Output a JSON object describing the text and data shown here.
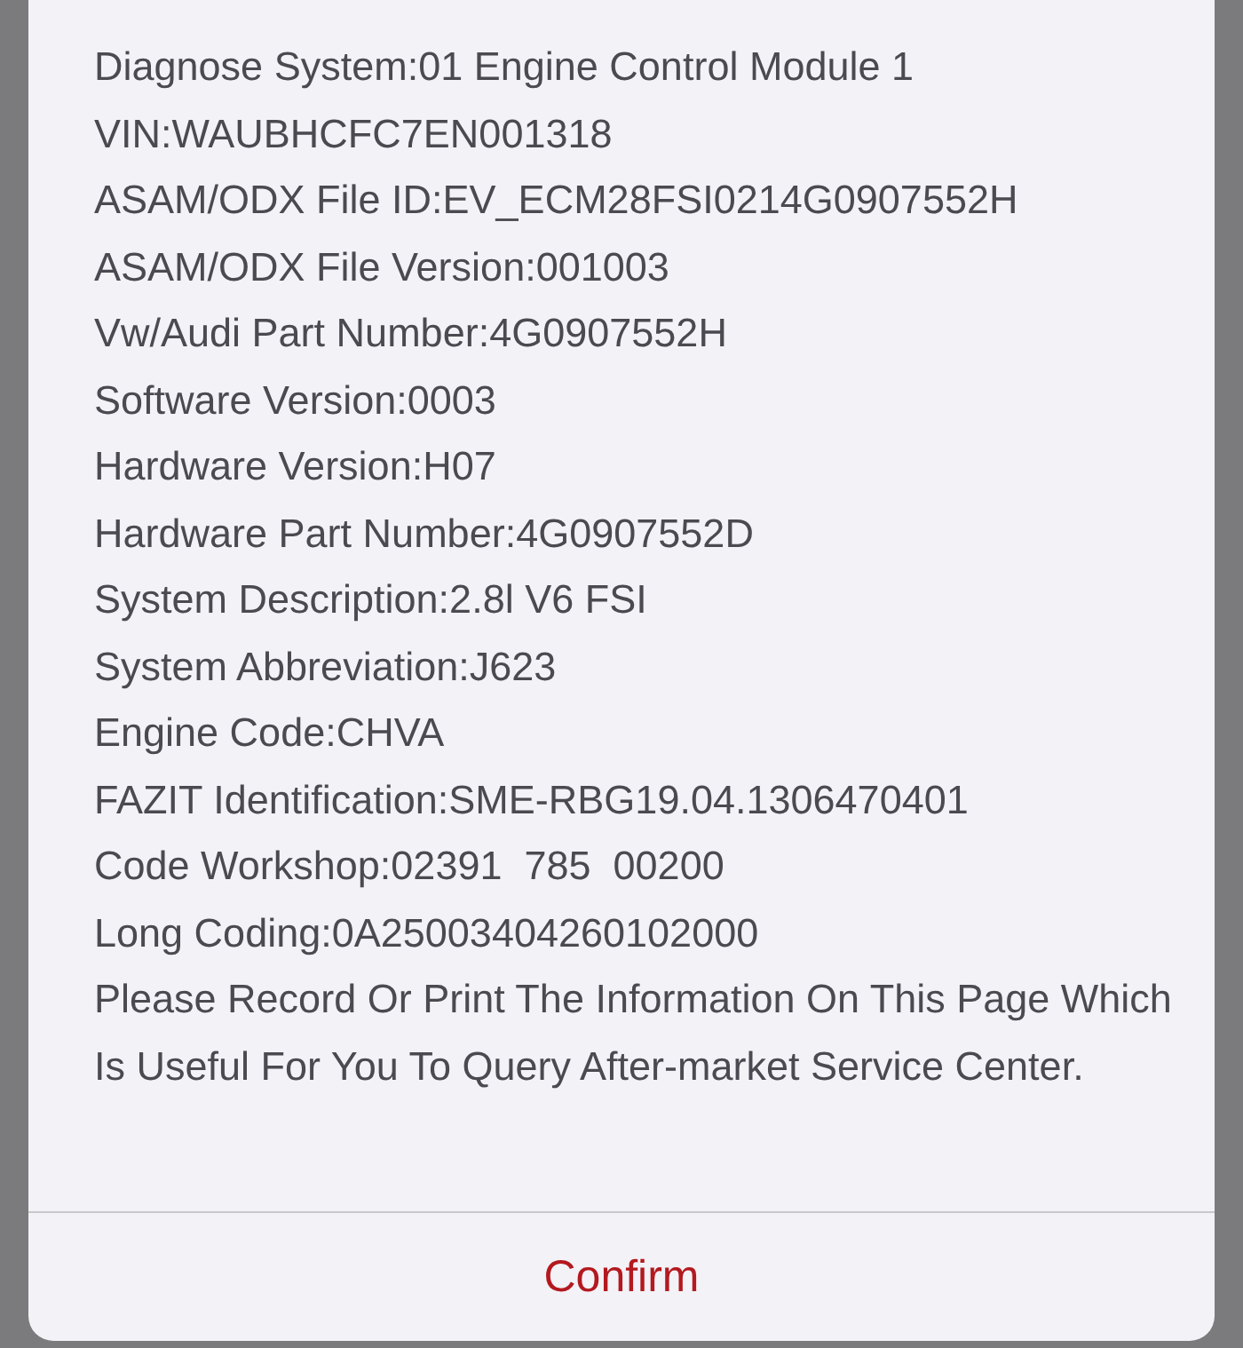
{
  "dialog": {
    "lines": [
      "Diagnose System:01 Engine Control Module 1",
      "VIN:WAUBHCFC7EN001318",
      "ASAM/ODX File ID:EV_ECM28FSI0214G0907552H",
      "ASAM/ODX File Version:001003",
      "Vw/Audi Part Number:4G0907552H",
      "Software Version:0003",
      "Hardware Version:H07",
      "Hardware Part Number:4G0907552D",
      "System Description:2.8l V6 FSI",
      "System Abbreviation:J623",
      "Engine Code:CHVA",
      "FAZIT Identification:SME-RBG19.04.1306470401",
      "Code Workshop:02391  785  00200",
      "Long Coding:0A25003404260102000"
    ],
    "note": "Please Record Or Print The Information On This Page Which Is Useful For You To Query After-market Service Center.",
    "buttons": [
      "Confirm"
    ]
  }
}
